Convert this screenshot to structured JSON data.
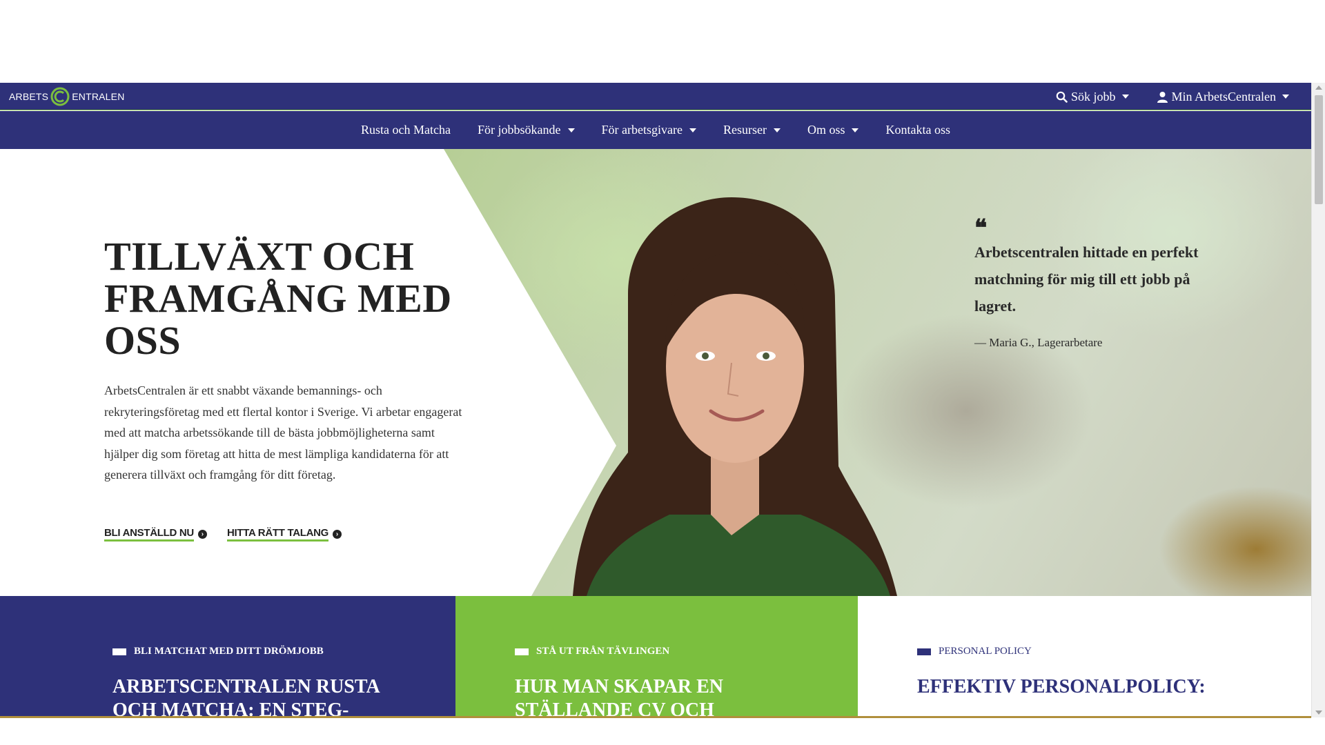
{
  "header": {
    "logo_left": "ARBETS",
    "logo_right": "ENTRALEN",
    "search_label": "Sök jobb",
    "account_label": "Min ArbetsCentralen"
  },
  "nav": {
    "items": [
      {
        "label": "Rusta och Matcha",
        "dropdown": false
      },
      {
        "label": "För jobbsökande",
        "dropdown": true
      },
      {
        "label": "För arbetsgivare",
        "dropdown": true
      },
      {
        "label": "Resurser",
        "dropdown": true
      },
      {
        "label": "Om oss",
        "dropdown": true
      },
      {
        "label": "Kontakta oss",
        "dropdown": false
      }
    ]
  },
  "hero": {
    "title": "TILLVÄXT OCH FRAMGÅNG MED OSS",
    "text": "ArbetsCentralen är ett snabbt växande bemannings- och rekryteringsföretag med ett flertal kontor i Sverige. Vi arbetar engagerat med att matcha arbetssökande till de bästa jobbmöjligheterna samt hjälper dig som företag att hitta de mest lämpliga kandidaterna för att generera tillväxt och framgång för ditt företag.",
    "cta_primary": "BLI ANSTÄLLD NU",
    "cta_secondary": "HITTA RÄTT TALANG",
    "quote_mark": "❝",
    "quote": "Arbetscentralen hittade en perfekt matchning för mig till ett jobb på lagret.",
    "quote_author": "— Maria G., Lagerarbetare"
  },
  "cards": [
    {
      "tag": "BLI MATCHAT MED DITT DRÖMJOBB",
      "title": "ARBETSCENTRALEN RUSTA OCH MATCHA: EN STEG-"
    },
    {
      "tag": "STÅ UT FRÅN TÄVLINGEN",
      "title": "HUR MAN SKAPAR EN STÄLLANDE CV OCH"
    },
    {
      "tag": "PERSONAL POLICY",
      "title": "EFFEKTIV PERSONALPOLICY:"
    }
  ],
  "colors": {
    "brand_navy": "#2e3179",
    "brand_green": "#7bbf3e"
  }
}
